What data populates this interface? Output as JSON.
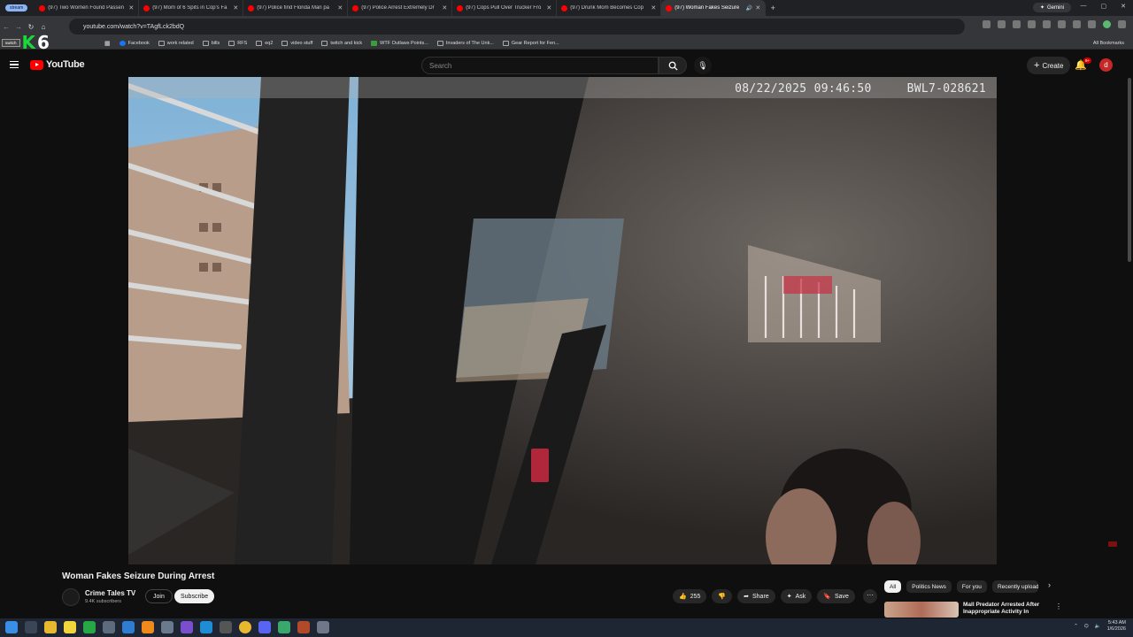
{
  "browser": {
    "tab_pill": "stream",
    "tabs": [
      {
        "title": "(97) Two Women Found Passen"
      },
      {
        "title": "(97) Mom of 6 Spits in Cop's Fa"
      },
      {
        "title": "(97) Police find Florida Man pa"
      },
      {
        "title": "(97) Police Arrest Extremely Dr"
      },
      {
        "title": "(97) Cops Pull Over Trucker Fro"
      },
      {
        "title": "(97) Drunk Mom Becomes Cop"
      },
      {
        "title": "(97) Woman Fakes Seizure"
      }
    ],
    "gemini_label": "Gemini",
    "url": "youtube.com/watch?v=TAgfLck2bdQ",
    "bookmarks": [
      "Facebook",
      "work related",
      "bills",
      "RFS",
      "eq2",
      "video stuff",
      "twitch and kick",
      "WTF Outlaws Points...",
      "Invaders of The Unk...",
      "Gear Report for Fen..."
    ],
    "all_bookmarks": "All Bookmarks"
  },
  "overlay": {
    "button_text": "switch",
    "k": "K",
    "six": "6"
  },
  "youtube": {
    "logo_text": "YouTube",
    "search_placeholder": "Search",
    "create_label": "Create",
    "notif_badge": "9+",
    "avatar_letter": "d"
  },
  "video": {
    "timestamp": "08/22/2025 09:46:50",
    "camera_id": "BWL7-028621",
    "title": "Woman Fakes Seizure During Arrest",
    "channel": "Crime Tales TV",
    "subscribers": "9.4K subscribers",
    "join_label": "Join",
    "subscribe_label": "Subscribe",
    "likes": "255",
    "share_label": "Share",
    "ask_label": "Ask",
    "save_label": "Save"
  },
  "sidebar": {
    "chips": [
      "All",
      "Politics News",
      "For you",
      "Recently uploaded"
    ],
    "recommendation_title": "Mall Predator Arrested After Inappropriate Activity In"
  },
  "taskbar": {
    "time": "5:43 AM",
    "date": "1/6/2026"
  },
  "colors": {
    "youtube_red": "#ff0000",
    "bg": "#0f0f0f",
    "accent_blue": "#8ab4f8",
    "kick_green": "#19d93a"
  }
}
